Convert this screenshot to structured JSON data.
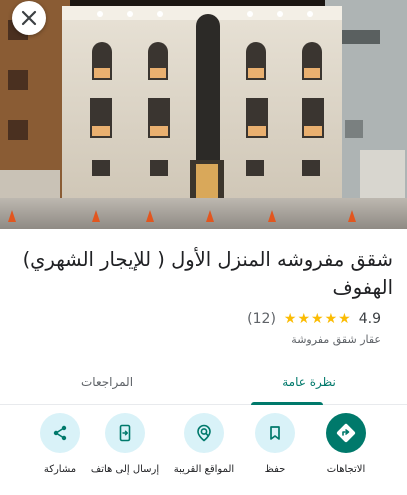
{
  "hero": {
    "image": "apartment-building-exterior-night-photo"
  },
  "place": {
    "title": "شقق مفروشه المنزل الأول ( للإيجار الشهري) الهفوف",
    "rating": "4.9",
    "stars": 5,
    "review_count": "(12)",
    "category": "عقار شقق مفروشة"
  },
  "tabs": [
    {
      "label": "نظرة عامة",
      "active": true
    },
    {
      "label": "المراجعات",
      "active": false
    }
  ],
  "actions": [
    {
      "label": "الاتجاهات",
      "icon": "directions-icon"
    },
    {
      "label": "حفظ",
      "icon": "bookmark-icon"
    },
    {
      "label": "المواقع القريبة",
      "icon": "nearby-icon"
    },
    {
      "label": "إرسال إلى هاتف",
      "icon": "send-to-phone-icon"
    },
    {
      "label": "مشاركة",
      "icon": "share-icon"
    }
  ],
  "colors": {
    "accent": "#00796b",
    "action_bg": "#d9f2f8",
    "star": "#fbbc04"
  }
}
